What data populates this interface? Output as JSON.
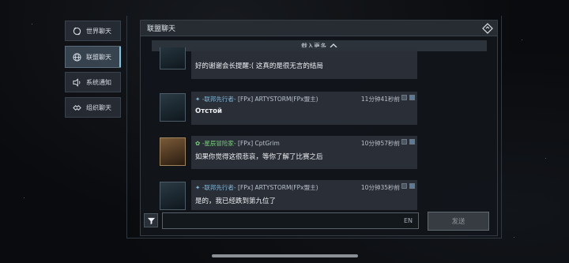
{
  "sidebar": {
    "items": [
      {
        "label": "世界聊天",
        "icon": "world-chat-icon",
        "active": false
      },
      {
        "label": "联盟聊天",
        "icon": "globe-icon",
        "active": true
      },
      {
        "label": "系统通知",
        "icon": "speaker-icon",
        "active": false
      },
      {
        "label": "组织聊天",
        "icon": "handshake-icon",
        "active": false
      }
    ]
  },
  "panel": {
    "title": "联盟聊天",
    "load_more": "载入更多",
    "messages": [
      {
        "sender": "",
        "text": "好的谢谢会长提醒:( 这真的是很无言的结局",
        "time": ""
      },
      {
        "rank": "联邦先行者",
        "sender": "[FPx] ARTYSTORM(FPx盟主)",
        "time": "11分钟41秒前",
        "text": "Отстой"
      },
      {
        "rank": "星辰冒险家",
        "sender": "[FPx] CptGrim",
        "time": "10分钟57秒前",
        "text": "如果你觉得这很悲哀，等你了解了比赛之后"
      },
      {
        "rank": "联邦先行者",
        "sender": "[FPx] ARTYSTORM(FPx盟主)",
        "time": "10分钟35秒前",
        "text": "是的，我已经跌到第九位了"
      }
    ]
  },
  "input": {
    "lang": "EN",
    "value": ""
  },
  "send_label": "发送",
  "colors": {
    "accent": "#79c7e0",
    "rank_blue": "#7fb7d8",
    "rank_green": "#79d07a"
  }
}
